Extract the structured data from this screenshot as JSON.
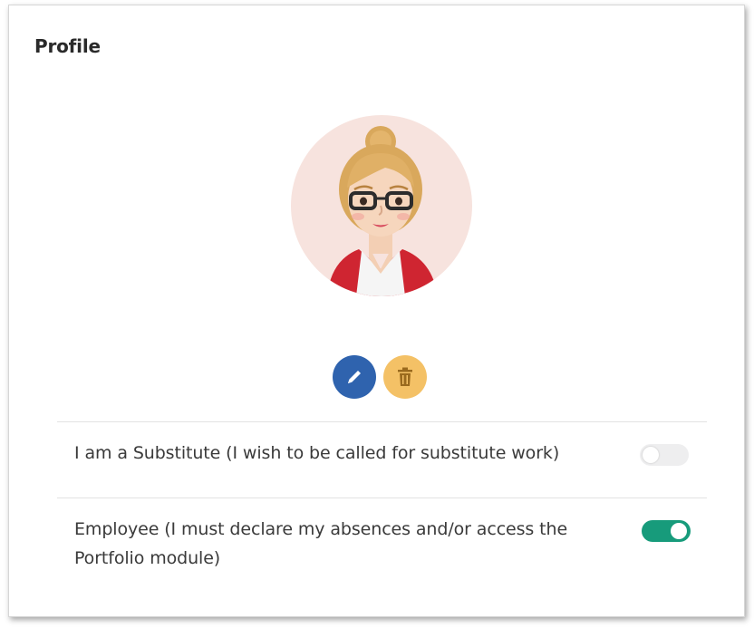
{
  "profile": {
    "title": "Profile"
  },
  "avatar": {
    "icon": "woman-with-glasses-avatar",
    "background": "#f7e3de"
  },
  "actions": {
    "edit_icon": "pencil-icon",
    "edit_color": "#2f63ae",
    "delete_icon": "trash-icon",
    "delete_color": "#f4c166"
  },
  "options": [
    {
      "label": "I am a Substitute (I wish to be called for substitute work)",
      "enabled": false
    },
    {
      "label": "Employee (I must declare my absences and/or access the Portfolio module)",
      "enabled": true
    }
  ],
  "colors": {
    "toggle_on": "#179b7b",
    "toggle_off": "#eeeeef"
  }
}
